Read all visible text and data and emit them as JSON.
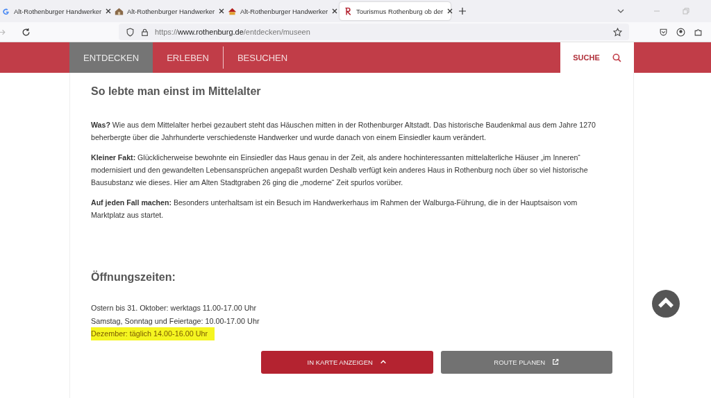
{
  "browser": {
    "tabs": [
      {
        "title": "Alt-Rothenburger Handwerker",
        "selected": false
      },
      {
        "title": "Alt-Rothenburger Handwerker",
        "selected": false
      },
      {
        "title": "Alt-Rothenburger Handwerker",
        "selected": false
      },
      {
        "title": "Tourismus Rothenburg ob der",
        "selected": true
      }
    ],
    "url": {
      "domain": "www.rothenburg.de",
      "path": "/entdecken/museen",
      "scheme": "https://"
    }
  },
  "nav": {
    "items": [
      {
        "label": "ENTDECKEN",
        "selected": true
      },
      {
        "label": "ERLEBEN",
        "selected": false
      },
      {
        "label": "BESUCHEN",
        "selected": false
      }
    ],
    "search_label": "SUCHE"
  },
  "content": {
    "heading": "So lebte man einst im Mittelalter",
    "paragraphs": [
      "**Was?** Wie aus dem Mittelalter herbei gezaubert steht das Häuschen mitten in der Rothenburger Altstadt. Das historische Baudenkmal aus dem Jahre 1270 beherbergte über die Jahrhunderte verschiedenste Handwerker und wurde danach von einem Einsiedler kaum verändert.",
      "**Kleiner Fakt:** Glücklicherweise bewohnte ein Einsiedler das Haus genau in der Zeit, als andere hochinteressanten mittelalterliche Häuser „im Inneren“ modernisiert und den gewandelten Lebensansprüchen angepaßt wurden Deshalb verfügt kein anderes Haus in Rothenburg noch über so viel historische Bausubstanz wie dieses. Hier am Alten Stadtgraben 26 ging die „moderne“ Zeit spurlos vorüber.",
      "**Auf jeden Fall machen:** Besonders unterhaltsam ist ein Besuch im Handwerkerhaus im Rahmen der Walburga-Führung, die in der Hauptsaison vom Marktplatz aus startet."
    ],
    "hours_heading": "Öffnungszeiten:",
    "hours": [
      {
        "text": "Ostern bis 31. Oktober: werktags 11.00-17.00 Uhr",
        "highlighted": false
      },
      {
        "text": "Samstag, Sonntag und Feiertage: 10.00-17.00 Uhr",
        "highlighted": false
      },
      {
        "text": "Dezember: täglich 14.00-16.00 Uhr",
        "highlighted": true
      }
    ],
    "buttons": [
      {
        "label": "IN KARTE ANZEIGEN",
        "kind": "map"
      },
      {
        "label": "ROUTE PLANEN",
        "kind": "route"
      }
    ]
  }
}
